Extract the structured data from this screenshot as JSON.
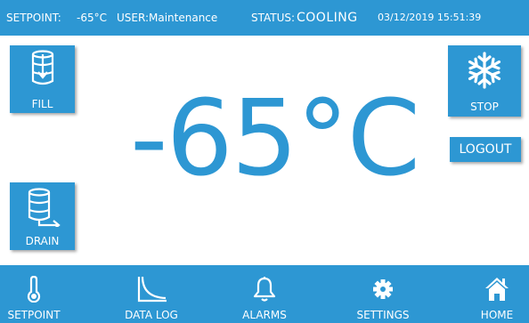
{
  "status_bar": {
    "setpoint_label": "SETPOINT:",
    "setpoint_value": "-65°C",
    "user_label": "USER:",
    "user_value": "Maintenance",
    "status_label": "STATUS:",
    "status_value": "COOLING",
    "datetime": "03/12/2019 15:51:39"
  },
  "main": {
    "temperature": "-65°C",
    "fill_label": "FILL",
    "drain_label": "DRAIN",
    "stop_label": "STOP",
    "logout_label": "LOGOUT"
  },
  "nav": {
    "items": [
      {
        "label": "SETPOINT",
        "icon": "thermometer-icon"
      },
      {
        "label": "DATA LOG",
        "icon": "curve-chart-icon"
      },
      {
        "label": "ALARMS",
        "icon": "bell-icon"
      },
      {
        "label": "SETTINGS",
        "icon": "gear-icon"
      },
      {
        "label": "HOME",
        "icon": "home-icon"
      }
    ]
  },
  "colors": {
    "accent": "#2d97d3",
    "background": "#ffffff",
    "text_on_accent": "#ffffff"
  }
}
